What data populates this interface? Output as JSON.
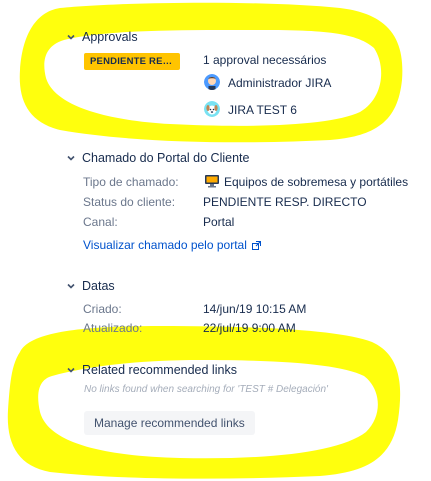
{
  "approvals": {
    "title": "Approvals",
    "status_lozenge": "PENDIENTE RESP. DI...",
    "approval_count": "1 approval necessários",
    "approvers": [
      {
        "name": "Administrador JIRA",
        "icon": "admin-avatar-icon"
      },
      {
        "name": "JIRA TEST 6",
        "icon": "dog-avatar-icon"
      }
    ]
  },
  "portal": {
    "title": "Chamado do Portal do Cliente",
    "rows": [
      {
        "label": "Tipo de chamado:",
        "value": "Equipos de sobremesa y portátiles",
        "icon": "desktop-computer-icon"
      },
      {
        "label": "Status do cliente:",
        "value": "PENDIENTE RESP. DIRECTO"
      },
      {
        "label": "Canal:",
        "value": "Portal"
      }
    ],
    "view_link": "Visualizar chamado pelo portal"
  },
  "dates": {
    "title": "Datas",
    "rows": [
      {
        "label": "Criado:",
        "value": "14/jun/19 10:15 AM"
      },
      {
        "label": "Atualizado:",
        "value": "22/jul/19 9:00 AM"
      }
    ]
  },
  "recommended": {
    "title": "Related recommended links",
    "empty_text": "No links found when searching for 'TEST # Delegación'",
    "manage_button": "Manage recommended links"
  },
  "colors": {
    "highlight": "#ffff00",
    "lozenge": "#ffc400",
    "link": "#0052cc",
    "text": "#172b4d",
    "label": "#6b778c"
  }
}
